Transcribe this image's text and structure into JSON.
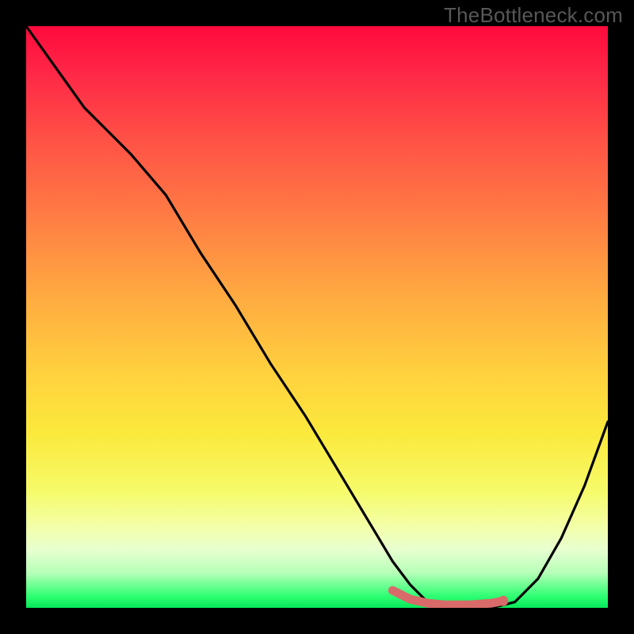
{
  "watermark": "TheBottleneck.com",
  "chart_data": {
    "type": "line",
    "title": "",
    "xlabel": "",
    "ylabel": "",
    "xlim": [
      0,
      100
    ],
    "ylim": [
      0,
      100
    ],
    "grid": false,
    "series": [
      {
        "name": "bottleneck-curve",
        "x": [
          0,
          5,
          10,
          18,
          24,
          30,
          36,
          42,
          48,
          54,
          60,
          63,
          66,
          69,
          72,
          76,
          80,
          84,
          88,
          92,
          96,
          100
        ],
        "y": [
          100,
          93,
          86,
          78,
          71,
          61,
          52,
          42,
          33,
          23,
          13,
          8,
          4,
          1,
          0,
          0,
          0,
          1,
          5,
          12,
          21,
          32
        ]
      },
      {
        "name": "highlight-flat-region",
        "x": [
          63,
          66,
          69,
          72,
          76,
          80,
          82
        ],
        "y": [
          3,
          1.5,
          0.8,
          0.5,
          0.5,
          0.8,
          1.2
        ]
      }
    ],
    "gradient_stops": [
      {
        "pos": 0,
        "color": "#ff0a3c"
      },
      {
        "pos": 50,
        "color": "#ffc23f"
      },
      {
        "pos": 85,
        "color": "#f4ff9a"
      },
      {
        "pos": 100,
        "color": "#06e85a"
      }
    ]
  }
}
